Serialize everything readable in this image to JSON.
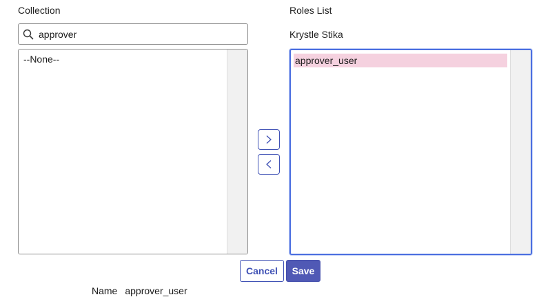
{
  "collection": {
    "label": "Collection",
    "search": {
      "value": "approver",
      "placeholder": ""
    },
    "items": [
      "--None--"
    ]
  },
  "roles": {
    "label": "Roles List",
    "user_name": "Krystle Stika",
    "items": [
      {
        "label": "approver_user",
        "selected": true
      }
    ]
  },
  "move_buttons": {
    "add_icon": "chevron-right-icon",
    "remove_icon": "chevron-left-icon"
  },
  "actions": {
    "cancel_label": "Cancel",
    "save_label": "Save"
  },
  "details": {
    "name_label": "Name",
    "name_value": "approver_user"
  },
  "colors": {
    "accent": "#3f51b5",
    "save_button": "#5059b5",
    "selected_item": "#f5d1df",
    "focus_border": "#4a6ee0"
  }
}
